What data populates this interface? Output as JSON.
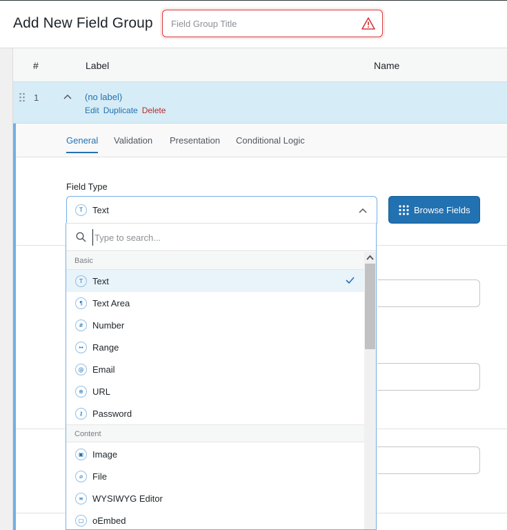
{
  "header": {
    "page_title": "Add New Field Group",
    "title_placeholder": "Field Group Title"
  },
  "table": {
    "col_num": "#",
    "col_label": "Label",
    "col_name": "Name"
  },
  "field": {
    "number": "1",
    "label": "(no label)",
    "actions": {
      "edit": "Edit",
      "duplicate": "Duplicate",
      "delete": "Delete"
    }
  },
  "tabs": [
    "General",
    "Validation",
    "Presentation",
    "Conditional Logic"
  ],
  "field_type": {
    "label": "Field Type",
    "selected": "Text",
    "selected_icon": "T",
    "browse_label": "Browse Fields"
  },
  "dropdown": {
    "search_placeholder": "Type to search...",
    "groups": [
      {
        "name": "Basic",
        "options": [
          {
            "label": "Text",
            "icon": "text-icon",
            "glyph": "T",
            "selected": true
          },
          {
            "label": "Text Area",
            "icon": "textarea-icon",
            "glyph": "¶",
            "selected": false
          },
          {
            "label": "Number",
            "icon": "number-icon",
            "glyph": "#",
            "selected": false
          },
          {
            "label": "Range",
            "icon": "range-icon",
            "glyph": "↔",
            "selected": false
          },
          {
            "label": "Email",
            "icon": "email-icon",
            "glyph": "@",
            "selected": false
          },
          {
            "label": "URL",
            "icon": "url-icon",
            "glyph": "⊕",
            "selected": false
          },
          {
            "label": "Password",
            "icon": "password-icon",
            "glyph": "⚷",
            "selected": false
          }
        ]
      },
      {
        "name": "Content",
        "options": [
          {
            "label": "Image",
            "icon": "image-icon",
            "glyph": "▣",
            "selected": false
          },
          {
            "label": "File",
            "icon": "file-icon",
            "glyph": "⌀",
            "selected": false
          },
          {
            "label": "WYSIWYG Editor",
            "icon": "wysiwyg-icon",
            "glyph": "≡",
            "selected": false
          },
          {
            "label": "oEmbed",
            "icon": "oembed-icon",
            "glyph": "▢",
            "selected": false
          }
        ]
      }
    ]
  },
  "colors": {
    "accent": "#2271b1",
    "row_highlight": "#d6ecf6",
    "error": "#d63638",
    "delete": "#b32d2e"
  }
}
